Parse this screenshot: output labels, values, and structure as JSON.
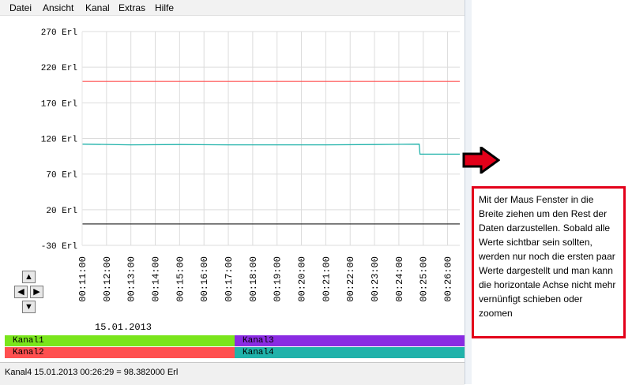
{
  "menu": {
    "datei": "Datei",
    "ansicht": "Ansicht",
    "kanal": "Kanal",
    "extras": "Extras",
    "hilfe": "Hilfe"
  },
  "chart_data": {
    "type": "line",
    "y_ticks": [
      "270 Erl",
      "220 Erl",
      "170 Erl",
      "120 Erl",
      "70 Erl",
      "20 Erl",
      "-30 Erl"
    ],
    "y_unit": "Erl",
    "ylim": [
      -30,
      270
    ],
    "x_ticks": [
      "00:11:00",
      "00:12:00",
      "00:13:00",
      "00:14:00",
      "00:15:00",
      "00:16:00",
      "00:17:00",
      "00:18:00",
      "00:19:00",
      "00:20:00",
      "00:21:00",
      "00:22:00",
      "00:23:00",
      "00:24:00",
      "00:25:00",
      "00:26:00"
    ],
    "date": "15.01.2013",
    "grid": true,
    "series": [
      {
        "name": "Kanal1",
        "color": "#7ae51c",
        "x": [
          "00:11:00",
          "00:26:30"
        ],
        "values": [
          0,
          0
        ]
      },
      {
        "name": "Kanal2",
        "color": "#ff5050",
        "x": [
          "00:11:00",
          "00:26:30"
        ],
        "values": [
          200,
          200
        ]
      },
      {
        "name": "Kanal3",
        "color": "#8a2be2",
        "x": [
          "00:11:00",
          "00:26:30"
        ],
        "values": [
          0,
          0
        ]
      },
      {
        "name": "Kanal4",
        "color": "#20b2aa",
        "x": [
          "00:11:00",
          "00:13:00",
          "00:15:00",
          "00:17:00",
          "00:19:00",
          "00:21:00",
          "00:23:00",
          "00:24:50",
          "00:25:00",
          "00:26:30"
        ],
        "values": [
          112,
          111,
          111.5,
          111,
          111,
          111,
          111.5,
          112,
          98,
          98
        ]
      }
    ]
  },
  "pan": {
    "up": "▲",
    "left": "◀",
    "right": "▶",
    "down": "▼"
  },
  "channels": {
    "k1": "Kanal1",
    "k2": "Kanal2",
    "k3": "Kanal3",
    "k4": "Kanal4"
  },
  "status": "Kanal4 15.01.2013 00:26:29 = 98.382000 Erl",
  "note": "Mit der Maus Fenster in die Breite ziehen um den Rest der Daten darzustellen. Sobald alle Werte sichtbar sein sollten, werden nur noch die ersten paar Werte dargestellt und man kann die horizontale Achse nicht mehr vernünfigt schieben oder zoomen"
}
